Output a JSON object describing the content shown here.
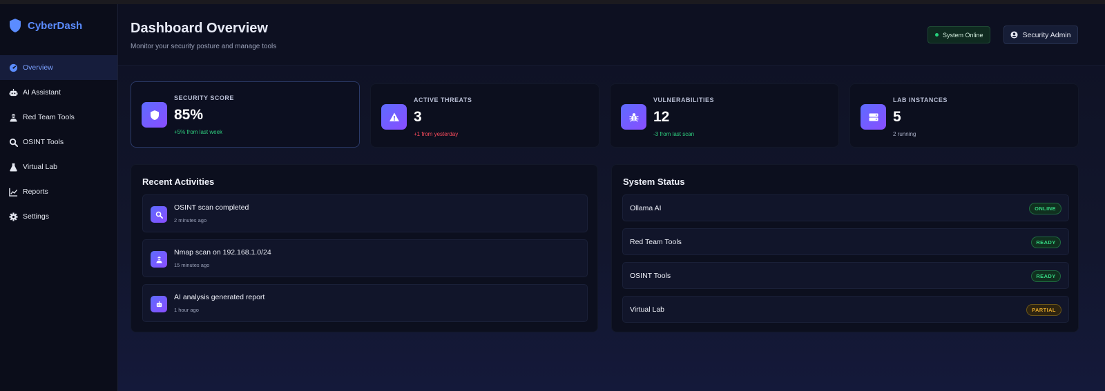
{
  "brand": {
    "name": "CyberDash"
  },
  "sidebar": {
    "items": [
      {
        "label": "Overview",
        "icon": "gauge-icon",
        "active": true
      },
      {
        "label": "AI Assistant",
        "icon": "robot-icon",
        "active": false
      },
      {
        "label": "Red Team Tools",
        "icon": "user-secret-icon",
        "active": false
      },
      {
        "label": "OSINT Tools",
        "icon": "search-icon",
        "active": false
      },
      {
        "label": "Virtual Lab",
        "icon": "flask-icon",
        "active": false
      },
      {
        "label": "Reports",
        "icon": "chart-line-icon",
        "active": false
      },
      {
        "label": "Settings",
        "icon": "gear-icon",
        "active": false
      }
    ]
  },
  "header": {
    "title": "Dashboard Overview",
    "subtitle": "Monitor your security posture and manage tools",
    "status": "System Online",
    "user": "Security Admin"
  },
  "stats": [
    {
      "label": "SECURITY SCORE",
      "value": "85%",
      "delta": "+5% from last week",
      "tone": "pos",
      "icon": "shield-icon"
    },
    {
      "label": "ACTIVE THREATS",
      "value": "3",
      "delta": "+1 from yesterday",
      "tone": "neg",
      "icon": "warning-icon"
    },
    {
      "label": "VULNERABILITIES",
      "value": "12",
      "delta": "-3 from last scan",
      "tone": "pos",
      "icon": "bug-icon"
    },
    {
      "label": "LAB INSTANCES",
      "value": "5",
      "delta": "2 running",
      "tone": "muted",
      "icon": "server-icon"
    }
  ],
  "activities": {
    "title": "Recent Activities",
    "items": [
      {
        "title": "OSINT scan completed",
        "time": "2 minutes ago",
        "icon": "search-icon"
      },
      {
        "title": "Nmap scan on 192.168.1.0/24",
        "time": "15 minutes ago",
        "icon": "user-secret-icon"
      },
      {
        "title": "AI analysis generated report",
        "time": "1 hour ago",
        "icon": "robot-icon"
      }
    ]
  },
  "system_status": {
    "title": "System Status",
    "items": [
      {
        "name": "Ollama AI",
        "status": "ONLINE",
        "tone": "green"
      },
      {
        "name": "Red Team Tools",
        "status": "READY",
        "tone": "green"
      },
      {
        "name": "OSINT Tools",
        "status": "READY",
        "tone": "green"
      },
      {
        "name": "Virtual Lab",
        "status": "PARTIAL",
        "tone": "amber"
      }
    ]
  },
  "colors": {
    "accent": "#5b8cff",
    "positive": "#2fd07f",
    "negative": "#ff4d5e",
    "warning": "#e2a62a"
  }
}
